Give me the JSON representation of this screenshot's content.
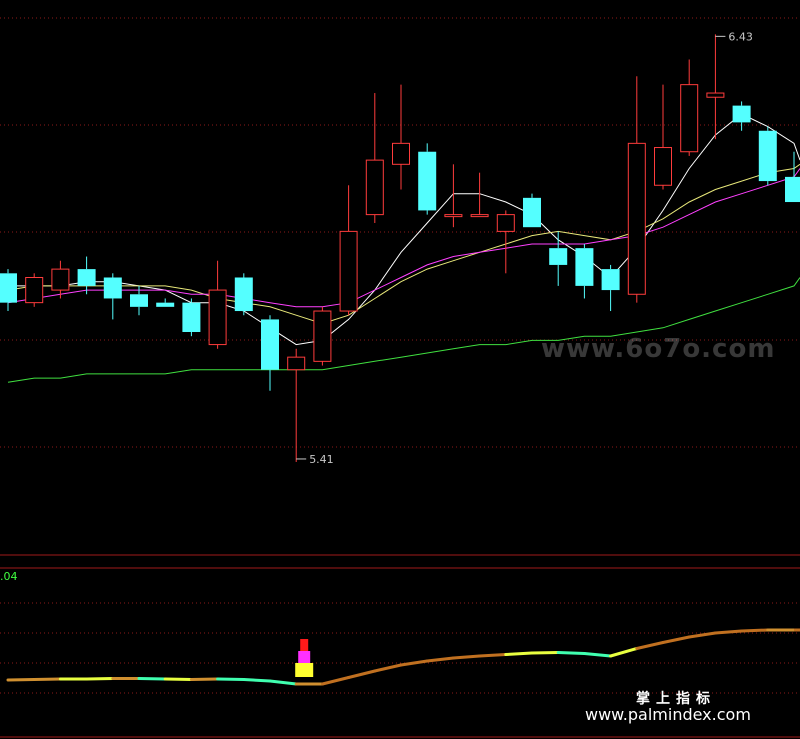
{
  "chart_data": {
    "type": "candlestick",
    "price_range": [
      5.2,
      6.5
    ],
    "candles": [
      {
        "o": 5.86,
        "h": 5.87,
        "l": 5.77,
        "c": 5.79
      },
      {
        "o": 5.79,
        "h": 5.86,
        "l": 5.78,
        "c": 5.85
      },
      {
        "o": 5.82,
        "h": 5.89,
        "l": 5.8,
        "c": 5.87
      },
      {
        "o": 5.87,
        "h": 5.9,
        "l": 5.81,
        "c": 5.83
      },
      {
        "o": 5.85,
        "h": 5.86,
        "l": 5.75,
        "c": 5.8
      },
      {
        "o": 5.81,
        "h": 5.83,
        "l": 5.76,
        "c": 5.78
      },
      {
        "o": 5.79,
        "h": 5.8,
        "l": 5.78,
        "c": 5.78
      },
      {
        "o": 5.79,
        "h": 5.8,
        "l": 5.71,
        "c": 5.72
      },
      {
        "o": 5.69,
        "h": 5.89,
        "l": 5.68,
        "c": 5.82
      },
      {
        "o": 5.85,
        "h": 5.86,
        "l": 5.76,
        "c": 5.77
      },
      {
        "o": 5.75,
        "h": 5.76,
        "l": 5.58,
        "c": 5.63
      },
      {
        "o": 5.63,
        "h": 5.68,
        "l": 5.41,
        "c": 5.66
      },
      {
        "o": 5.65,
        "h": 5.78,
        "l": 5.64,
        "c": 5.77
      },
      {
        "o": 5.77,
        "h": 6.07,
        "l": 5.76,
        "c": 5.96
      },
      {
        "o": 6.0,
        "h": 6.29,
        "l": 5.98,
        "c": 6.13
      },
      {
        "o": 6.12,
        "h": 6.31,
        "l": 6.06,
        "c": 6.17
      },
      {
        "o": 6.15,
        "h": 6.17,
        "l": 6.0,
        "c": 6.01
      },
      {
        "o": 6.0,
        "h": 6.12,
        "l": 5.97,
        "c": 6.0
      },
      {
        "o": 6.0,
        "h": 6.1,
        "l": 6.0,
        "c": 6.0
      },
      {
        "o": 5.96,
        "h": 6.01,
        "l": 5.86,
        "c": 6.0
      },
      {
        "o": 6.04,
        "h": 6.05,
        "l": 5.97,
        "c": 5.97
      },
      {
        "o": 5.92,
        "h": 5.96,
        "l": 5.83,
        "c": 5.88
      },
      {
        "o": 5.92,
        "h": 5.93,
        "l": 5.8,
        "c": 5.83
      },
      {
        "o": 5.87,
        "h": 5.88,
        "l": 5.77,
        "c": 5.82
      },
      {
        "o": 5.81,
        "h": 6.33,
        "l": 5.79,
        "c": 6.17
      },
      {
        "o": 6.07,
        "h": 6.31,
        "l": 6.06,
        "c": 6.16
      },
      {
        "o": 6.15,
        "h": 6.37,
        "l": 6.14,
        "c": 6.31
      },
      {
        "o": 6.28,
        "h": 6.43,
        "l": 6.18,
        "c": 6.29
      },
      {
        "o": 6.26,
        "h": 6.27,
        "l": 6.2,
        "c": 6.22
      },
      {
        "o": 6.2,
        "h": 6.21,
        "l": 6.07,
        "c": 6.08
      },
      {
        "o": 6.09,
        "h": 6.15,
        "l": 6.03,
        "c": 6.03
      }
    ],
    "moving_averages": [
      {
        "color": "#ffffff",
        "values": [
          5.83,
          5.83,
          5.83,
          5.84,
          5.84,
          5.83,
          5.82,
          5.79,
          5.79,
          5.77,
          5.73,
          5.69,
          5.7,
          5.75,
          5.82,
          5.91,
          5.98,
          6.05,
          6.05,
          6.03,
          6.0,
          5.94,
          5.9,
          5.85,
          5.92,
          6.01,
          6.11,
          6.19,
          6.24,
          6.21,
          6.17
        ]
      },
      {
        "color": "#e8e87a",
        "values": [
          5.82,
          5.83,
          5.83,
          5.83,
          5.83,
          5.83,
          5.83,
          5.82,
          5.8,
          5.79,
          5.78,
          5.76,
          5.74,
          5.76,
          5.8,
          5.84,
          5.87,
          5.89,
          5.91,
          5.93,
          5.95,
          5.96,
          5.95,
          5.94,
          5.96,
          5.99,
          6.03,
          6.06,
          6.08,
          6.1,
          6.11
        ]
      },
      {
        "color": "#ff40ff",
        "values": [
          5.79,
          5.8,
          5.81,
          5.82,
          5.82,
          5.82,
          5.82,
          5.81,
          5.81,
          5.8,
          5.79,
          5.78,
          5.78,
          5.79,
          5.82,
          5.85,
          5.88,
          5.9,
          5.91,
          5.92,
          5.93,
          5.93,
          5.93,
          5.94,
          5.95,
          5.97,
          6.0,
          6.03,
          6.05,
          6.07,
          6.09
        ]
      },
      {
        "color": "#40e040",
        "values": [
          5.6,
          5.61,
          5.61,
          5.62,
          5.62,
          5.62,
          5.62,
          5.63,
          5.63,
          5.63,
          5.63,
          5.63,
          5.63,
          5.64,
          5.65,
          5.66,
          5.67,
          5.68,
          5.69,
          5.69,
          5.7,
          5.7,
          5.71,
          5.71,
          5.72,
          5.73,
          5.75,
          5.77,
          5.79,
          5.81,
          5.83
        ]
      }
    ],
    "annotations": {
      "high": "6.43",
      "low": "5.41"
    },
    "indicator": {
      "label": ".04",
      "values": [
        0.4,
        0.41,
        0.42,
        0.42,
        0.43,
        0.43,
        0.42,
        0.41,
        0.42,
        0.41,
        0.38,
        0.32,
        0.32,
        0.45,
        0.58,
        0.7,
        0.78,
        0.84,
        0.88,
        0.91,
        0.94,
        0.95,
        0.93,
        0.88,
        1.03,
        1.15,
        1.26,
        1.34,
        1.38,
        1.4,
        1.4
      ]
    }
  },
  "watermarks": {
    "site1": "www.6o7o.com",
    "brand": "掌上指标",
    "site2": "www.palmindex.com"
  }
}
